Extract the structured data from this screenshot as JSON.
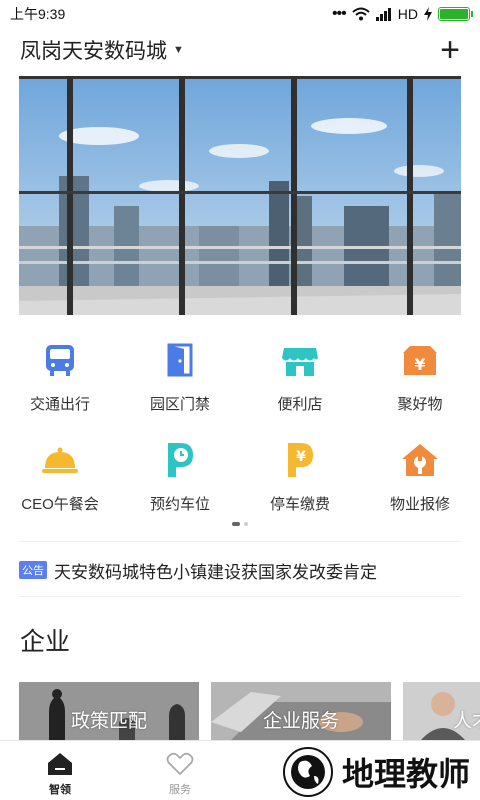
{
  "status_bar": {
    "time": "上午9:39",
    "network": "HD",
    "battery_level": 1.0
  },
  "header": {
    "title": "凤岗天安数码城",
    "caret_icon": "caret-down-icon",
    "add_icon": "plus-icon"
  },
  "banner": {
    "image": "city-skyline-from-office-window"
  },
  "services": [
    {
      "label": "交通出行",
      "icon": "bus-icon",
      "color": "#4b7be5"
    },
    {
      "label": "园区门禁",
      "icon": "door-icon",
      "color": "#4b7be5"
    },
    {
      "label": "便利店",
      "icon": "store-icon",
      "color": "#2ec4c4"
    },
    {
      "label": "聚好物",
      "icon": "yen-box-icon",
      "color": "#f08a3c"
    },
    {
      "label": "CEO午餐会",
      "icon": "food-cloche-icon",
      "color": "#f5b82e"
    },
    {
      "label": "预约车位",
      "icon": "parking-clock-icon",
      "color": "#2ec4c4"
    },
    {
      "label": "停车缴费",
      "icon": "parking-yen-icon",
      "color": "#f5b82e"
    },
    {
      "label": "物业报修",
      "icon": "house-wrench-icon",
      "color": "#f08a3c"
    }
  ],
  "pager": {
    "pages": 2,
    "current": 1
  },
  "notice": {
    "tag": "公告",
    "text": "天安数码城特色小镇建设获国家发改委肯定"
  },
  "enterprise": {
    "title": "企业",
    "cards": [
      {
        "label": "政策匹配",
        "image": "chess-pieces"
      },
      {
        "label": "企业服务",
        "image": "laptop-hands"
      },
      {
        "label": "人才",
        "image": "person-smiling"
      }
    ]
  },
  "tabbar": {
    "tabs": [
      {
        "label": "智领",
        "icon": "home-icon",
        "active": true
      },
      {
        "label": "服务",
        "icon": "heart-icon",
        "active": false
      },
      {
        "label": "",
        "icon": "",
        "active": false
      },
      {
        "label": "",
        "icon": "",
        "active": false
      }
    ]
  },
  "watermark": {
    "text": "地理教师"
  },
  "colors": {
    "accent": "#5b7ef0",
    "battery": "#2bb42b"
  }
}
